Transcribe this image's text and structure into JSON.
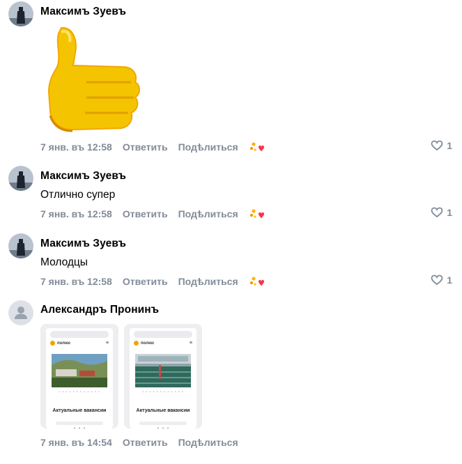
{
  "comments": [
    {
      "author": "Максимъ Зуевъ",
      "text": "",
      "date": "7 янв. въ 12:58",
      "reply": "Ответить",
      "share": "Подѣлиться",
      "likes": "1"
    },
    {
      "author": "Максимъ Зуевъ",
      "text": "Отлично супер",
      "date": "7 янв. въ 12:58",
      "reply": "Ответить",
      "share": "Подѣлиться",
      "likes": "1"
    },
    {
      "author": "Максимъ Зуевъ",
      "text": "Молодцы",
      "date": "7 янв. въ 12:58",
      "reply": "Ответить",
      "share": "Подѣлиться",
      "likes": "1"
    },
    {
      "author": "Александръ Пронинъ",
      "text": "",
      "date": "7 янв. въ 14:54",
      "reply": "Ответить",
      "share": "Подѣлиться",
      "attachments": [
        {
          "brand": "полюс",
          "caption": "Актуальные вакансии"
        },
        {
          "brand": "полюс",
          "caption": "Актуальные вакансии"
        }
      ]
    }
  ],
  "icons": {
    "sticker": "thumbs-up-sticker",
    "reaction": "reaction-icon",
    "like": "heart-icon",
    "avatar_default": "user-icon"
  },
  "colors": {
    "meta": "#818c99",
    "sticker": "#f5c400",
    "default_avatar": "#dde1e7"
  }
}
